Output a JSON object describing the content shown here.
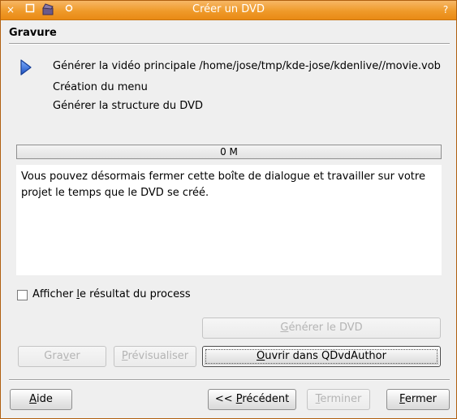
{
  "window": {
    "title": "Créer un DVD"
  },
  "titlebar": {
    "close_glyph": "×",
    "help_glyph": "?"
  },
  "section": {
    "title": "Gravure"
  },
  "steps": [
    {
      "label": "Générer la vidéo principale  /home/jose/tmp/kde-jose/kdenlive//movie.vob",
      "active": true
    },
    {
      "label": "Création du menu",
      "active": false
    },
    {
      "label": "Générer la structure du DVD",
      "active": false
    }
  ],
  "progress": {
    "text": "0 M",
    "value": 0
  },
  "message": "Vous pouvez désormais fermer cette boîte de dialogue et travailler sur votre projet le temps que le DVD se créé.",
  "options": {
    "show_process_result": {
      "prefix": "Afficher ",
      "mnemonic": "l",
      "suffix": "e résultat du process",
      "checked": false
    }
  },
  "buttons": {
    "generate_dvd": {
      "prefix": "",
      "mnemonic": "G",
      "suffix": "énérer le DVD",
      "enabled": false
    },
    "burn": {
      "prefix": "Gra",
      "mnemonic": "v",
      "suffix": "er",
      "enabled": false
    },
    "preview": {
      "prefix": "",
      "mnemonic": "P",
      "suffix": "révisualiser",
      "enabled": false
    },
    "open_qdvdauthor": {
      "prefix": "",
      "mnemonic": "O",
      "suffix": "uvrir dans QDvdAuthor",
      "enabled": true
    },
    "help": {
      "prefix": "",
      "mnemonic": "A",
      "suffix": "ide",
      "enabled": true
    },
    "previous": {
      "prefix": "<< ",
      "mnemonic": "P",
      "suffix": "récédent",
      "enabled": true
    },
    "finish": {
      "prefix": "",
      "mnemonic": "T",
      "suffix": "erminer",
      "enabled": false
    },
    "close": {
      "prefix": "",
      "mnemonic": "F",
      "suffix": "ermer",
      "enabled": true
    }
  },
  "colors": {
    "titlebar": "#ef9a2a",
    "step_arrow": "#2d5fc8"
  }
}
